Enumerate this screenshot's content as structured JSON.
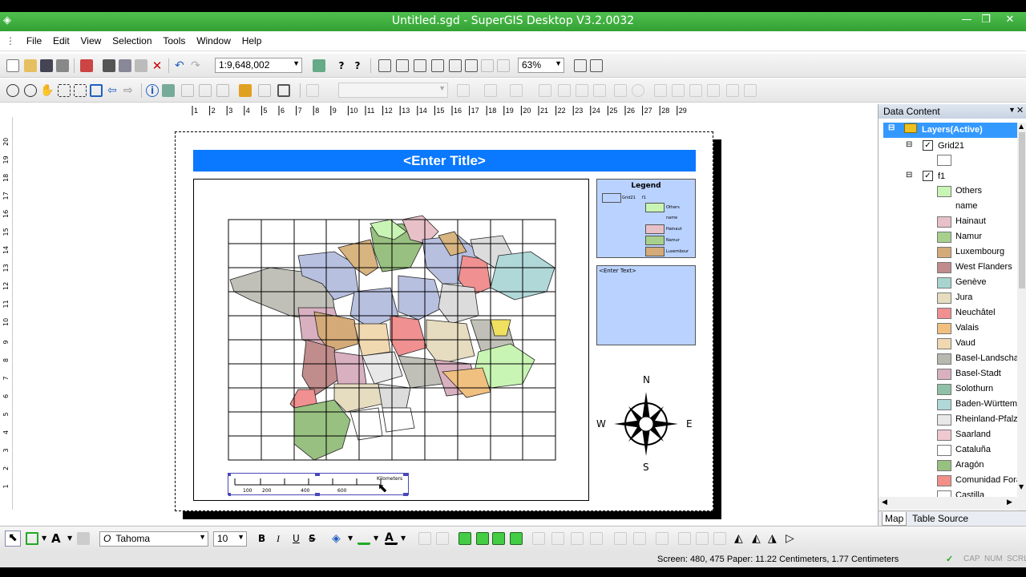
{
  "window": {
    "title": "Untitled.sgd - SuperGIS Desktop V3.2.0032"
  },
  "menu": [
    "File",
    "Edit",
    "View",
    "Selection",
    "Tools",
    "Window",
    "Help"
  ],
  "toolbar1": {
    "scale": "1:9,648,002",
    "zoom": "63%"
  },
  "toolbar2": {
    "style_combo": ""
  },
  "layout": {
    "map_title": "<Enter Title>",
    "legend_title": "Legend",
    "enter_text": "<Enter Text>",
    "scalebar_unit": "Kilometers",
    "scalebar_ticks": [
      "100",
      "200",
      "400",
      "600"
    ]
  },
  "legend_items": [
    "Grid21",
    "f1",
    "Others",
    "name",
    "Hainaut",
    "Namur",
    "Luxembour"
  ],
  "north_arrow": {
    "n": "N",
    "s": "S",
    "e": "E",
    "w": "W"
  },
  "ruler": {
    "h": [
      "1",
      "2",
      "3",
      "4",
      "5",
      "6",
      "7",
      "8",
      "9",
      "10",
      "11",
      "12",
      "13",
      "14",
      "15",
      "16",
      "17",
      "18",
      "19",
      "20",
      "21",
      "22",
      "23",
      "24",
      "25",
      "26",
      "27",
      "28",
      "29"
    ],
    "v": [
      "20",
      "19",
      "18",
      "17",
      "16",
      "15",
      "14",
      "13",
      "12",
      "11",
      "10",
      "9",
      "8",
      "7",
      "6",
      "5",
      "4",
      "3",
      "2",
      "1"
    ]
  },
  "data_content": {
    "title": "Data Content",
    "root": "Layers(Active)",
    "layers": [
      {
        "name": "Grid21",
        "checked": true
      },
      {
        "name": "f1",
        "checked": true
      }
    ],
    "classes": [
      {
        "label": "Others",
        "color": "#c8f5b4"
      },
      {
        "label": "name",
        "color": ""
      },
      {
        "label": "Hainaut",
        "color": "#e8c0c8"
      },
      {
        "label": "Namur",
        "color": "#a8d08c"
      },
      {
        "label": "Luxembourg",
        "color": "#d4aa78"
      },
      {
        "label": "West Flanders",
        "color": "#c08c8c"
      },
      {
        "label": "Genève",
        "color": "#a8d4d0"
      },
      {
        "label": "Jura",
        "color": "#e6dcc0"
      },
      {
        "label": "Neuchâtel",
        "color": "#f09090"
      },
      {
        "label": "Valais",
        "color": "#f0c080"
      },
      {
        "label": "Vaud",
        "color": "#f0d8b0"
      },
      {
        "label": "Basel-Landschaft",
        "color": "#b8b8b0"
      },
      {
        "label": "Basel-Stadt",
        "color": "#d8b0c0"
      },
      {
        "label": "Solothurn",
        "color": "#90c0a8"
      },
      {
        "label": "Baden-Württemberg",
        "color": "#b0d8d8"
      },
      {
        "label": "Rheinland-Pfalz",
        "color": "#e8e8e8"
      },
      {
        "label": "Saarland",
        "color": "#f0c8d0"
      },
      {
        "label": "Cataluña",
        "color": "#ffffff"
      },
      {
        "label": "Aragón",
        "color": "#98c080"
      },
      {
        "label": "Comunidad Foral",
        "color": "#f09088"
      },
      {
        "label": "Castilla",
        "color": "#ffffff"
      }
    ],
    "tabs": [
      "Map",
      "Table Source"
    ]
  },
  "bottom_toolbar": {
    "font": "Tahoma",
    "size": "10",
    "bold": "B",
    "italic": "I",
    "underline": "U",
    "strike": "S"
  },
  "status": {
    "text": "Screen: 480, 475  Paper: 11.22 Centimeters, 1.77 Centimeters",
    "caps": "CAP",
    "num": "NUM",
    "scrl": "SCRL"
  }
}
